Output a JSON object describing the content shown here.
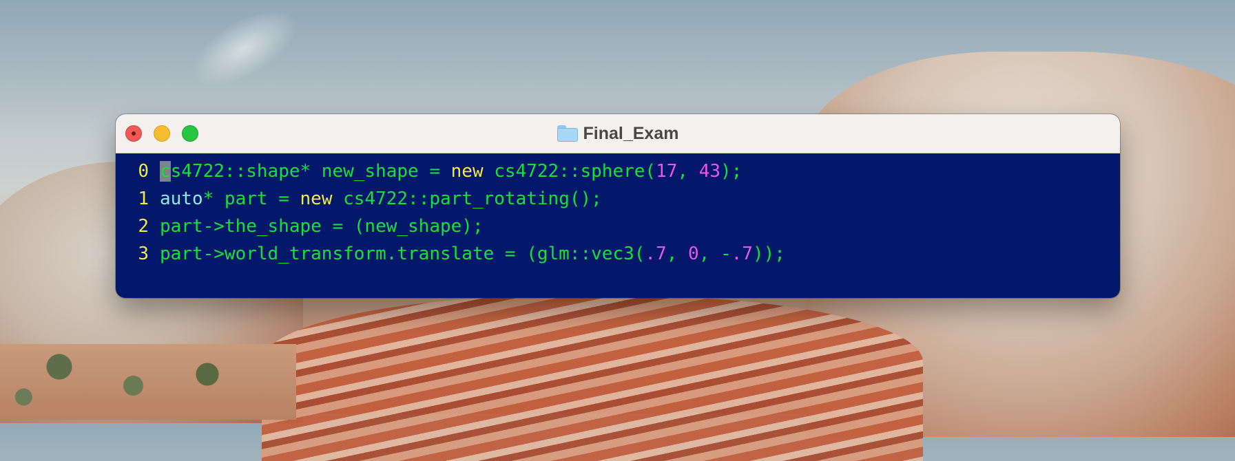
{
  "window": {
    "title": "Final_Exam",
    "folder_icon": "folder-icon",
    "traffic_lights": [
      "close",
      "minimize",
      "maximize"
    ]
  },
  "terminal": {
    "lines": [
      {
        "number": "0",
        "segments": [
          {
            "text": "c",
            "style": "cursor"
          },
          {
            "text": "s4722::shape* new_shape = ",
            "style": "code"
          },
          {
            "text": "new",
            "style": "kw"
          },
          {
            "text": " cs4722::sphere(",
            "style": "code"
          },
          {
            "text": "17",
            "style": "num"
          },
          {
            "text": ", ",
            "style": "code"
          },
          {
            "text": "43",
            "style": "num"
          },
          {
            "text": ");",
            "style": "code"
          }
        ]
      },
      {
        "number": "1",
        "segments": [
          {
            "text": "auto",
            "style": "auto"
          },
          {
            "text": "* part = ",
            "style": "code"
          },
          {
            "text": "new",
            "style": "kw"
          },
          {
            "text": " cs4722::part_rotating();",
            "style": "code"
          }
        ]
      },
      {
        "number": "2",
        "segments": [
          {
            "text": "part->the_shape = (new_shape);",
            "style": "code"
          }
        ]
      },
      {
        "number": "3",
        "segments": [
          {
            "text": "part->world_transform.translate = (glm::vec3(",
            "style": "code"
          },
          {
            "text": ".7",
            "style": "num"
          },
          {
            "text": ", ",
            "style": "code"
          },
          {
            "text": "0",
            "style": "num"
          },
          {
            "text": ", -",
            "style": "code"
          },
          {
            "text": ".7",
            "style": "num"
          },
          {
            "text": "));",
            "style": "code"
          }
        ]
      }
    ]
  }
}
